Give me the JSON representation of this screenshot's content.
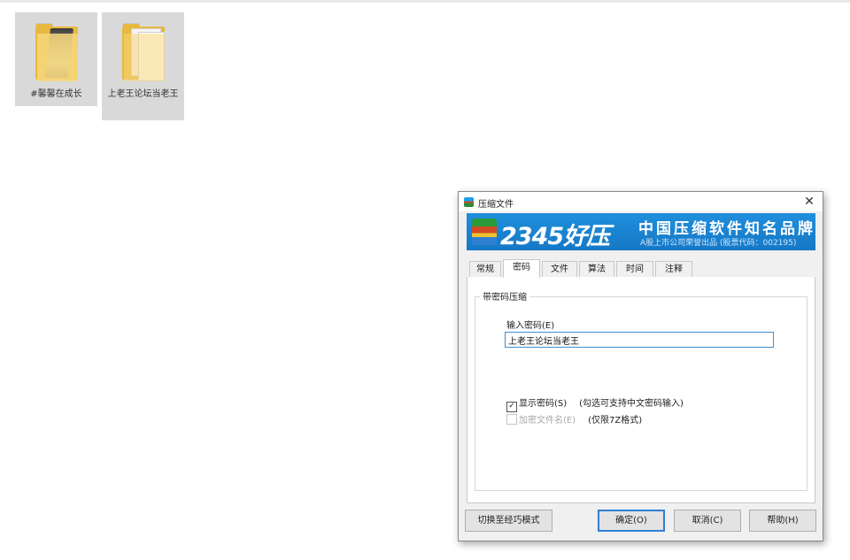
{
  "desktop": {
    "icons": [
      {
        "label": "#馨馨在成长"
      },
      {
        "label": "上老王论坛当老王"
      }
    ]
  },
  "dialog": {
    "title": "压缩文件",
    "close_label": "✕",
    "banner": {
      "brand": "2345好压",
      "slogan": "中国压缩软件知名品牌",
      "subtext": "A股上市公司荣誉出品 (股票代码：002195)"
    },
    "tabs": [
      "常规",
      "密码",
      "文件",
      "算法",
      "时间",
      "注释"
    ],
    "active_tab": "密码",
    "group_title": "带密码压缩",
    "password_label": "输入密码(E)",
    "password_value": "上老王论坛当老王",
    "show_password": {
      "label": "显示密码(S)",
      "checked": true,
      "hint": "(勾选可支持中文密码输入)"
    },
    "encrypt_filenames": {
      "label": "加密文件名(E)",
      "checked": false,
      "enabled": false,
      "hint": "(仅限7Z格式)"
    },
    "buttons": {
      "switch_mode": "切换至经巧模式",
      "ok": "确定(O)",
      "cancel": "取消(C)",
      "help": "帮助(H)"
    }
  }
}
